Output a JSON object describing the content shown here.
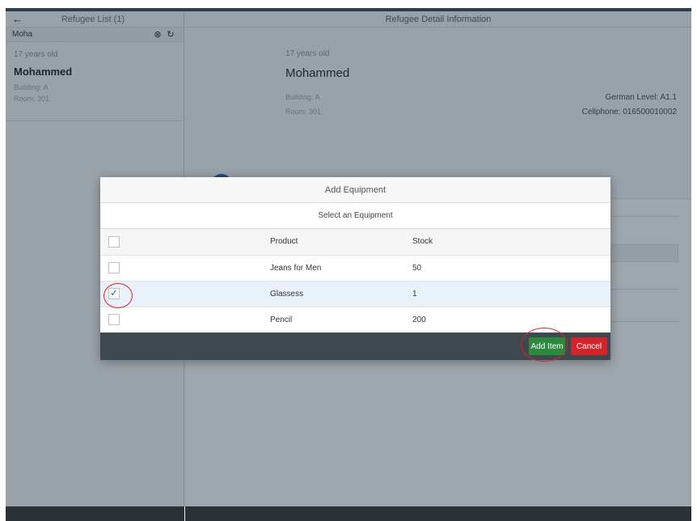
{
  "master": {
    "title": "Refugee List (1)",
    "search_value": "Moha",
    "item": {
      "age": "17 years old",
      "name": "Mohammed",
      "building": "Building: A",
      "room": "Room: 301"
    }
  },
  "detail": {
    "title": "Refugee Detail Information",
    "age": "17 years old",
    "name": "Mohammed",
    "building": "Building: A",
    "room": "Room: 301",
    "german_level": "German Level: A1.1",
    "cellphone": "Cellphone: 016500010002"
  },
  "dialog": {
    "title": "Add Equipment",
    "subtitle": "Select an Equipment",
    "columns": {
      "product": "Product",
      "stock": "Stock"
    },
    "rows": [
      {
        "product": "Jeans for Men",
        "stock": "50",
        "checked": false
      },
      {
        "product": "Glassess",
        "stock": "1",
        "checked": true
      },
      {
        "product": "Pencil",
        "stock": "200",
        "checked": false
      }
    ],
    "add_label": "Add Item",
    "cancel_label": "Cancel"
  },
  "colors": {
    "add_button": "#2c8a3e",
    "cancel_button": "#d5232a",
    "annotation": "#e02020",
    "accent": "#2f6fb0"
  },
  "icons": {
    "back": "arrow-left-icon",
    "clear": "clear-icon",
    "refresh": "refresh-icon",
    "tab": "tab-icon"
  }
}
